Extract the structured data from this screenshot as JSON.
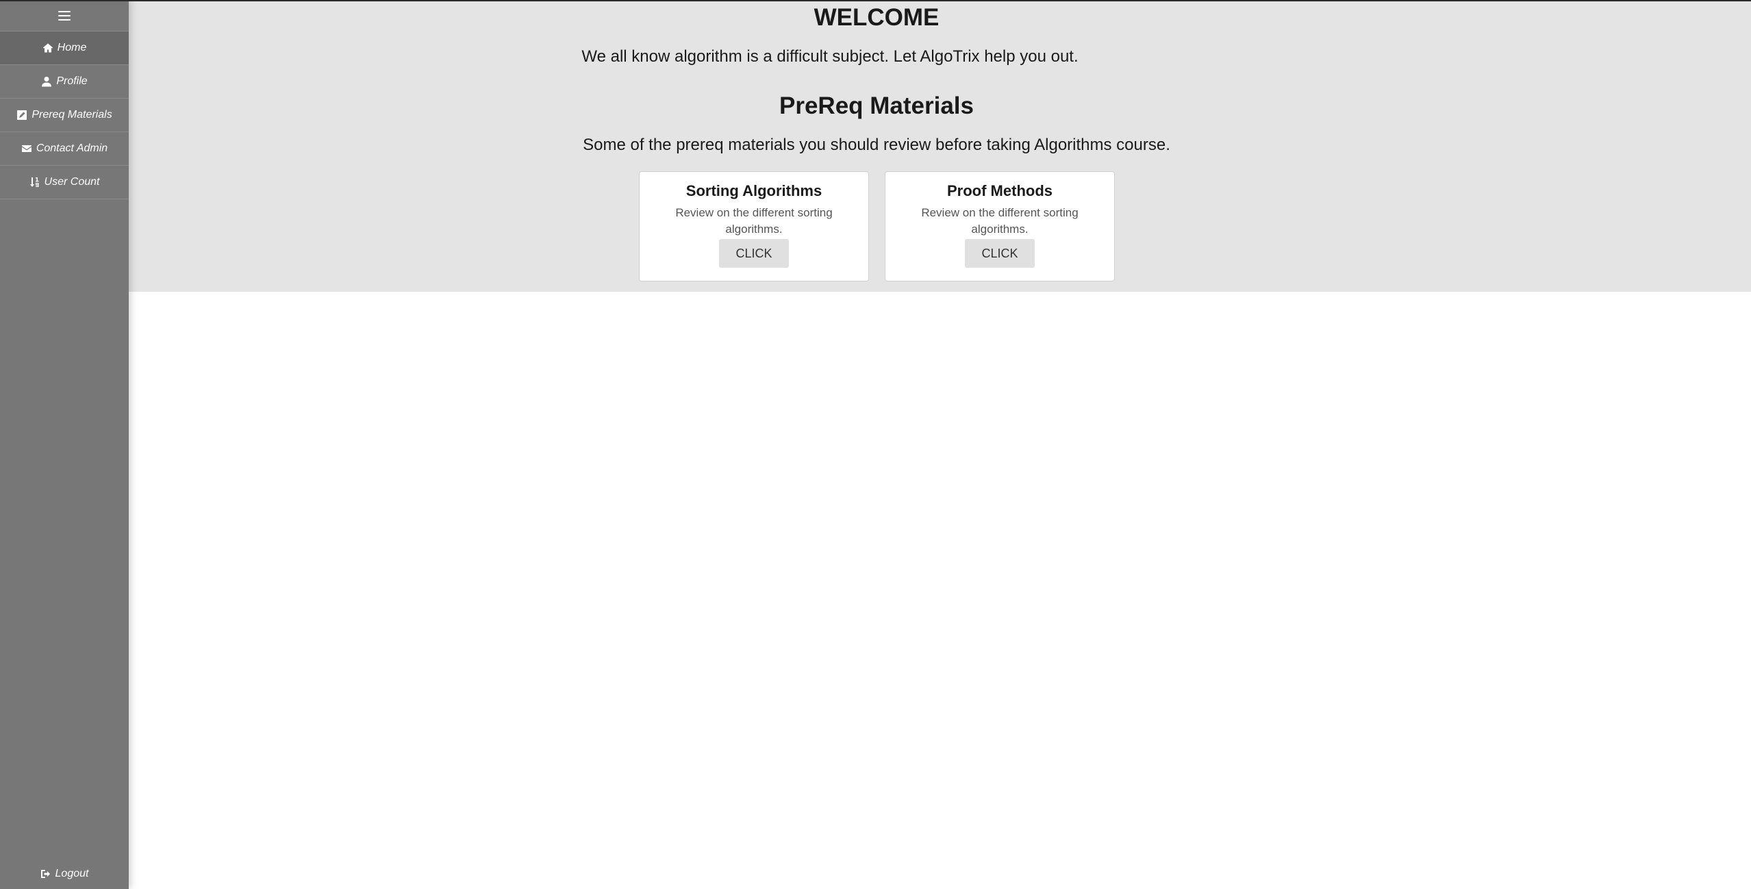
{
  "sidebar": {
    "toggle_icon": "hamburger-menu-icon",
    "items": [
      {
        "label": "Home",
        "icon": "home-icon"
      },
      {
        "label": "Profile",
        "icon": "user-icon"
      },
      {
        "label": "Prereq Materials",
        "icon": "edit-square-icon"
      },
      {
        "label": "Contact Admin",
        "icon": "envelope-icon"
      },
      {
        "label": "User Count",
        "icon": "sort-numeric-icon"
      }
    ],
    "logout": {
      "label": "Logout",
      "icon": "sign-out-icon"
    }
  },
  "hero": {
    "welcome_title": "WELCOME",
    "welcome_text": "We all know algorithm is a difficult subject. Let AlgoTrix help you out.",
    "prereq_title": "PreReq Materials",
    "prereq_text": "Some of the prereq materials you should review before taking Algorithms course."
  },
  "cards": [
    {
      "title": "Sorting Algorithms",
      "description": "Review on the different sorting algorithms.",
      "button": "CLICK"
    },
    {
      "title": "Proof Methods",
      "description": "Review on the different sorting algorithms.",
      "button": "CLICK"
    }
  ],
  "colors": {
    "sidebar_bg": "#777777",
    "sidebar_active": "#686868",
    "hero_bg": "#e4e4e4",
    "button_bg": "#e0e0e0"
  }
}
